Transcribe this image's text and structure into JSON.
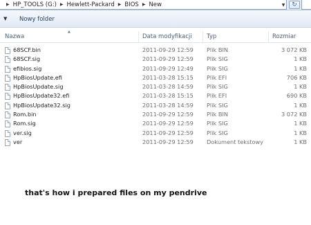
{
  "address_bar": {
    "crumbs": [
      "HP_TOOLS (G:)",
      "Hewlett-Packard",
      "BIOS",
      "New"
    ]
  },
  "toolbar": {
    "new_folder_label": "Nowy folder"
  },
  "columns": {
    "name": "Nazwa",
    "date": "Data modyfikacji",
    "type": "Typ",
    "size": "Rozmiar"
  },
  "files": [
    {
      "name": "68SCF.bin",
      "date": "2011-09-29 12:59",
      "type": "Plik BIN",
      "size": "3 072 KB"
    },
    {
      "name": "68SCF.sig",
      "date": "2011-09-29 12:59",
      "type": "Plik SIG",
      "size": "1 KB"
    },
    {
      "name": "efibios.sig",
      "date": "2011-09-29 12:49",
      "type": "Plik SIG",
      "size": "1 KB"
    },
    {
      "name": "HpBiosUpdate.efi",
      "date": "2011-03-28 15:15",
      "type": "Plik EFI",
      "size": "706 KB"
    },
    {
      "name": "HpBiosUpdate.sig",
      "date": "2011-03-28 14:59",
      "type": "Plik SIG",
      "size": "1 KB"
    },
    {
      "name": "HpBiosUpdate32.efi",
      "date": "2011-03-28 15:15",
      "type": "Plik EFI",
      "size": "690 KB"
    },
    {
      "name": "HpBiosUpdate32.sig",
      "date": "2011-03-28 14:59",
      "type": "Plik SIG",
      "size": "1 KB"
    },
    {
      "name": "Rom.bin",
      "date": "2011-09-29 12:59",
      "type": "Plik BIN",
      "size": "3 072 KB"
    },
    {
      "name": "Rom.sig",
      "date": "2011-09-29 12:59",
      "type": "Plik SIG",
      "size": "1 KB"
    },
    {
      "name": "ver.sig",
      "date": "2011-09-29 12:59",
      "type": "Plik SIG",
      "size": "1 KB"
    },
    {
      "name": "ver",
      "date": "2011-09-29 12:59",
      "type": "Dokument tekstowy",
      "size": "1 KB"
    }
  ],
  "caption": "that's how i prepared files on my pendrive",
  "icons": {
    "file": "file-icon",
    "refresh": "refresh-icon",
    "breadcrumb_separator": "chevron-right-icon",
    "toolbar_menu": "chevron-down-icon",
    "sort": "sort-up-icon"
  },
  "colors": {
    "address_bg": "#e4ebf5",
    "toolbar_bg": "#e2eaf5",
    "header_text": "#4c607a",
    "detail_text": "#6d6d6d"
  }
}
